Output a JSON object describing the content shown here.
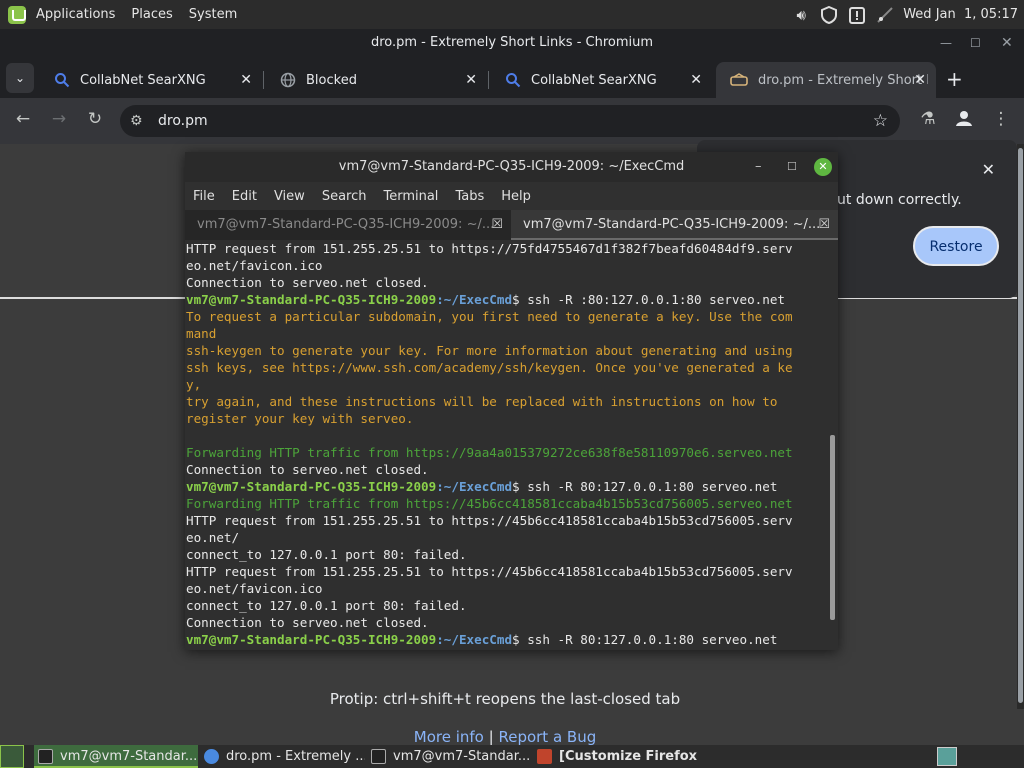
{
  "top_panel": {
    "menu": [
      "Applications",
      "Places",
      "System"
    ],
    "clock": "Wed Jan  1, 05:17"
  },
  "chromium": {
    "window_title": "dro.pm - Extremely Short Links - Chromium",
    "tabs": [
      {
        "label": "CollabNet SearXNG",
        "icon": "search-icon"
      },
      {
        "label": "Blocked",
        "icon": "globe-icon"
      },
      {
        "label": "CollabNet SearXNG",
        "icon": "search-icon"
      },
      {
        "label": "dro.pm - Extremely Short L",
        "icon": "sleep-icon"
      }
    ],
    "url": "dro.pm",
    "restore_message": "ut down correctly.",
    "restore_button": "Restore",
    "protip": "Protip: ctrl+shift+t reopens the last-closed tab",
    "link_more_info": "More info",
    "link_separator": "|",
    "link_report_bug": "Report a Bug"
  },
  "terminal": {
    "title": "vm7@vm7-Standard-PC-Q35-ICH9-2009: ~/ExecCmd",
    "menu": [
      "File",
      "Edit",
      "View",
      "Search",
      "Terminal",
      "Tabs",
      "Help"
    ],
    "tabs": [
      "vm7@vm7-Standard-PC-Q35-ICH9-2009: ~/...",
      "vm7@vm7-Standard-PC-Q35-ICH9-2009: ~/..."
    ],
    "prompt_user": "vm7@vm7-Standard-PC-Q35-ICH9-2009",
    "prompt_path": ":~/ExecCmd",
    "lines": [
      {
        "t": "HTTP request from 151.255.25.51 to https://75fd4755467d1f382f7beafd60484df9.serv"
      },
      {
        "t": "eo.net/favicon.ico"
      },
      {
        "t": "Connection to serveo.net closed."
      },
      {
        "p": true,
        "t": "$ ssh -R :80:127.0.0.1:80 serveo.net"
      },
      {
        "c": "orange",
        "t": "To request a particular subdomain, you first need to generate a key. Use the com"
      },
      {
        "c": "orange",
        "t": "mand"
      },
      {
        "c": "orange",
        "t": "ssh-keygen to generate your key. For more information about generating and using"
      },
      {
        "c": "orange",
        "t": "ssh keys, see https://www.ssh.com/academy/ssh/keygen. Once you've generated a ke"
      },
      {
        "c": "orange",
        "t": "y,"
      },
      {
        "c": "orange",
        "t": "try again, and these instructions will be replaced with instructions on how to"
      },
      {
        "c": "orange",
        "t": "register your key with serveo."
      },
      {
        "t": ""
      },
      {
        "c": "green",
        "t": "Forwarding HTTP traffic from https://9aa4a015379272ce638f8e58110970e6.serveo.net"
      },
      {
        "t": "Connection to serveo.net closed."
      },
      {
        "p": true,
        "t": "$ ssh -R 80:127.0.0.1:80 serveo.net"
      },
      {
        "c": "green",
        "t": "Forwarding HTTP traffic from https://45b6cc418581ccaba4b15b53cd756005.serveo.net"
      },
      {
        "t": "HTTP request from 151.255.25.51 to https://45b6cc418581ccaba4b15b53cd756005.serv"
      },
      {
        "t": "eo.net/"
      },
      {
        "t": "connect_to 127.0.0.1 port 80: failed."
      },
      {
        "t": "HTTP request from 151.255.25.51 to https://45b6cc418581ccaba4b15b53cd756005.serv"
      },
      {
        "t": "eo.net/favicon.ico"
      },
      {
        "t": "connect_to 127.0.0.1 port 80: failed."
      },
      {
        "t": "Connection to serveo.net closed."
      },
      {
        "p": true,
        "t": "$ ssh -R 80:127.0.0.1:80 serveo.net"
      }
    ]
  },
  "taskbar": {
    "tasks": [
      {
        "label": "vm7@vm7-Standar...",
        "icon": "terminal-icon",
        "active": true
      },
      {
        "label": "dro.pm - Extremely ...",
        "icon": "chromium-icon",
        "active": false
      },
      {
        "label": "vm7@vm7-Standar...",
        "icon": "terminal-icon",
        "active": false
      },
      {
        "label": "[Customize Firefox ...",
        "icon": "firefox-icon",
        "active": false
      }
    ]
  },
  "colors": {
    "accent": "#8bc34a",
    "terminal_orange": "#d8a031",
    "terminal_green": "#4ca43a",
    "link": "#8ab4f8",
    "restore_button": "#a8c7fa"
  }
}
